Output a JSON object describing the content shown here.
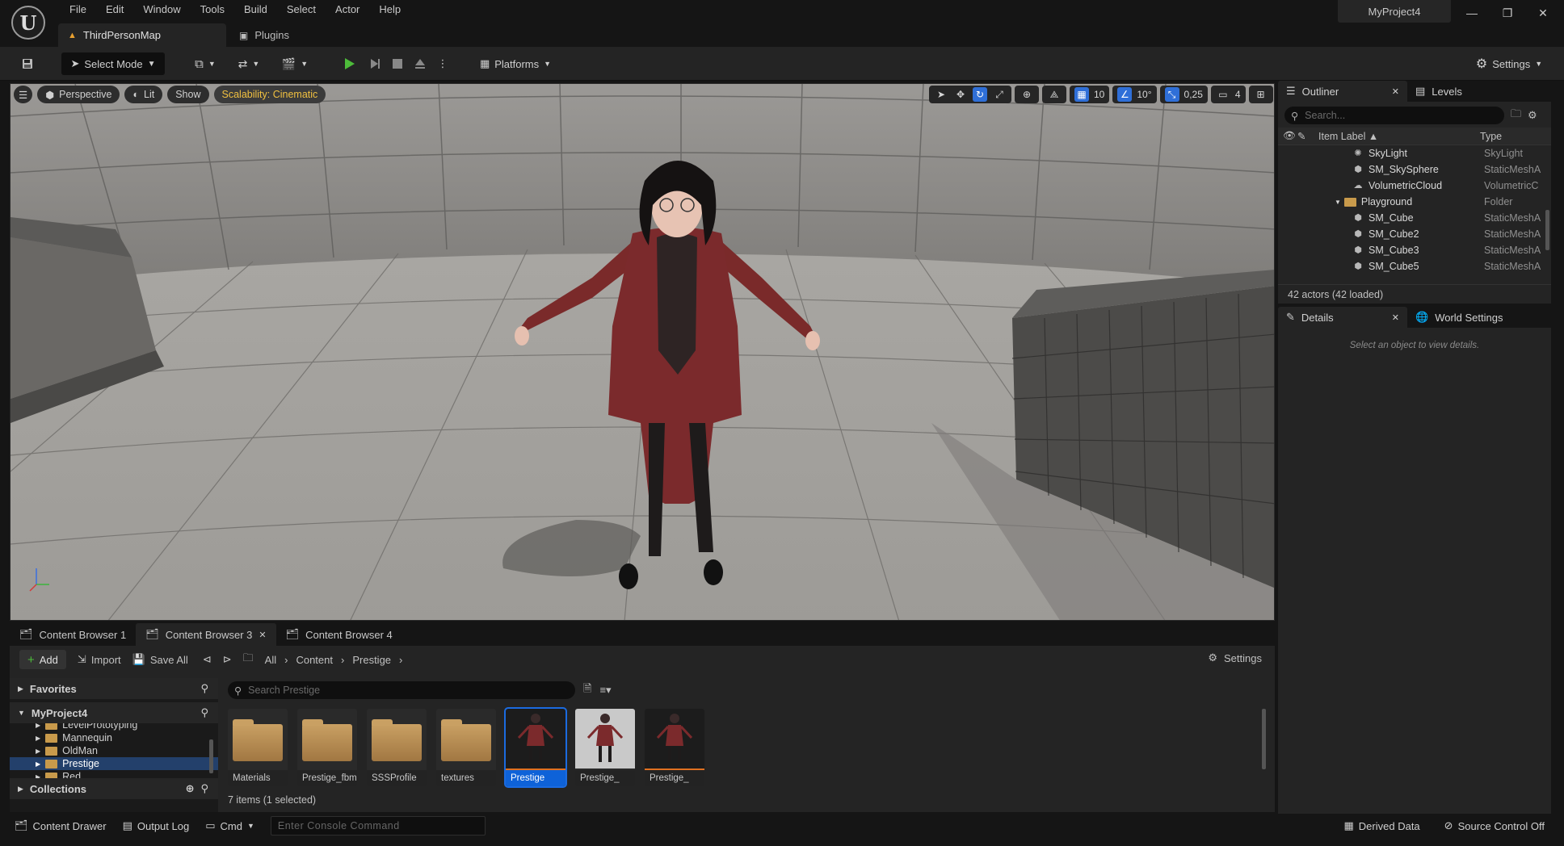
{
  "menu": [
    "File",
    "Edit",
    "Window",
    "Tools",
    "Build",
    "Select",
    "Actor",
    "Help"
  ],
  "tabs": {
    "map": "ThirdPersonMap",
    "plugins": "Plugins"
  },
  "project_name": "MyProject4",
  "toolbar": {
    "select_mode": "Select Mode",
    "platforms": "Platforms",
    "settings": "Settings"
  },
  "viewport": {
    "perspective": "Perspective",
    "lit": "Lit",
    "show": "Show",
    "scalability": "Scalability: Cinematic",
    "grid_snap": "10",
    "rot_snap": "10°",
    "scale_snap": "0,25",
    "camera_speed": "4"
  },
  "outliner": {
    "tab": "Outliner",
    "tab2": "Levels",
    "search_placeholder": "Search...",
    "col_label": "Item Label ▲",
    "col_type": "Type",
    "rows": [
      {
        "label": "SkyLight",
        "type": "SkyLight",
        "icon": "light-icon"
      },
      {
        "label": "SM_SkySphere",
        "type": "StaticMeshA",
        "icon": "mesh-icon"
      },
      {
        "label": "VolumetricCloud",
        "type": "VolumetricC",
        "icon": "cloud-icon"
      },
      {
        "label": "Playground",
        "type": "Folder",
        "icon": "folder-icon"
      },
      {
        "label": "SM_Cube",
        "type": "StaticMeshA",
        "icon": "mesh-icon"
      },
      {
        "label": "SM_Cube2",
        "type": "StaticMeshA",
        "icon": "mesh-icon"
      },
      {
        "label": "SM_Cube3",
        "type": "StaticMeshA",
        "icon": "mesh-icon"
      },
      {
        "label": "SM_Cube5",
        "type": "StaticMeshA",
        "icon": "mesh-icon"
      }
    ],
    "status": "42 actors (42 loaded)"
  },
  "details": {
    "tab": "Details",
    "tab2": "World Settings",
    "empty": "Select an object to view details."
  },
  "content_browser": {
    "tabs": [
      "Content Browser 1",
      "Content Browser 3",
      "Content Browser 4"
    ],
    "add": "Add",
    "import": "Import",
    "save_all": "Save All",
    "breadcrumb": [
      "All",
      "Content",
      "Prestige"
    ],
    "settings": "Settings",
    "search_placeholder": "Search Prestige",
    "favorites": "Favorites",
    "project": "MyProject4",
    "collections": "Collections",
    "tree": [
      "LevelPrototyping",
      "Mannequin",
      "OldMan",
      "Prestige",
      "Red"
    ],
    "assets": [
      {
        "label": "Materials",
        "kind": "folder"
      },
      {
        "label": "Prestige_fbm",
        "kind": "folder"
      },
      {
        "label": "SSSProfile",
        "kind": "folder"
      },
      {
        "label": "textures",
        "kind": "folder"
      },
      {
        "label": "Prestige",
        "kind": "mesh"
      },
      {
        "label": "Prestige_",
        "kind": "mesh-light"
      },
      {
        "label": "Prestige_",
        "kind": "mesh"
      }
    ],
    "status": "7 items (1 selected)"
  },
  "statusbar": {
    "content_drawer": "Content Drawer",
    "output_log": "Output Log",
    "cmd": "Cmd",
    "console_placeholder": "Enter Console Command",
    "derived_data": "Derived Data",
    "source_control": "Source Control Off"
  }
}
